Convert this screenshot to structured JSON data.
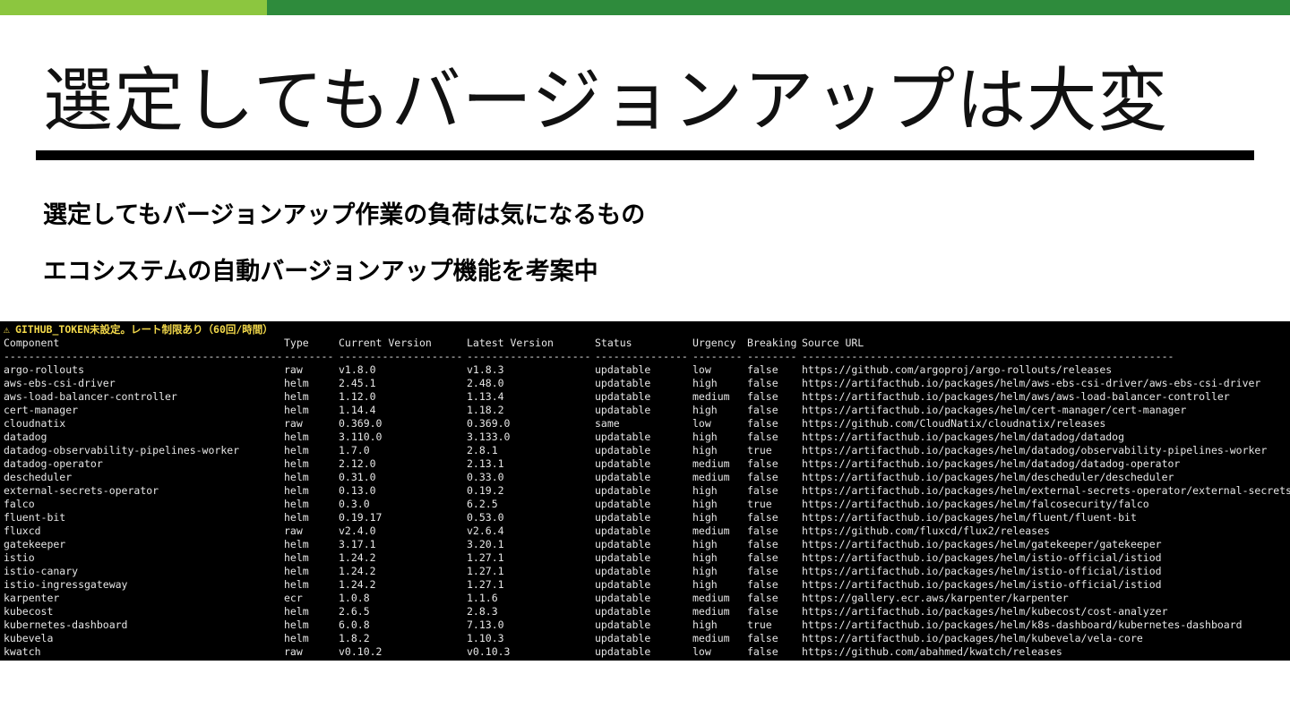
{
  "colors": {
    "bar_left": "#8cc63f",
    "bar_right": "#2e8b3c",
    "warning": "#f2d84a"
  },
  "slide": {
    "title": "選定してもバージョンアップは大変",
    "bullets": [
      "選定してもバージョンアップ作業の負荷は気になるもの",
      "エコシステムの自動バージョンアップ機能を考案中"
    ]
  },
  "terminal": {
    "warning_icon": "⚠",
    "warning_text": "GITHUB_TOKEN未設定。レート制限あり（60回/時間）",
    "headers": [
      "Component",
      "Type",
      "Current Version",
      "Latest Version",
      "Status",
      "Urgency",
      "Breaking",
      "Source URL"
    ],
    "separators": [
      "---------------------------------------------",
      "--------",
      "--------------------",
      "--------------------",
      "---------------",
      "--------",
      "--------",
      "------------------------------------------------------------"
    ],
    "rows": [
      [
        "argo-rollouts",
        "raw",
        "v1.8.0",
        "v1.8.3",
        "updatable",
        "low",
        "false",
        "https://github.com/argoproj/argo-rollouts/releases"
      ],
      [
        "aws-ebs-csi-driver",
        "helm",
        "2.45.1",
        "2.48.0",
        "updatable",
        "high",
        "false",
        "https://artifacthub.io/packages/helm/aws-ebs-csi-driver/aws-ebs-csi-driver"
      ],
      [
        "aws-load-balancer-controller",
        "helm",
        "1.12.0",
        "1.13.4",
        "updatable",
        "medium",
        "false",
        "https://artifacthub.io/packages/helm/aws/aws-load-balancer-controller"
      ],
      [
        "cert-manager",
        "helm",
        "1.14.4",
        "1.18.2",
        "updatable",
        "high",
        "false",
        "https://artifacthub.io/packages/helm/cert-manager/cert-manager"
      ],
      [
        "cloudnatix",
        "raw",
        "0.369.0",
        "0.369.0",
        "same",
        "low",
        "false",
        "https://github.com/CloudNatix/cloudnatix/releases"
      ],
      [
        "datadog",
        "helm",
        "3.110.0",
        "3.133.0",
        "updatable",
        "high",
        "false",
        "https://artifacthub.io/packages/helm/datadog/datadog"
      ],
      [
        "datadog-observability-pipelines-worker",
        "helm",
        "1.7.0",
        "2.8.1",
        "updatable",
        "high",
        "true",
        "https://artifacthub.io/packages/helm/datadog/observability-pipelines-worker"
      ],
      [
        "datadog-operator",
        "helm",
        "2.12.0",
        "2.13.1",
        "updatable",
        "medium",
        "false",
        "https://artifacthub.io/packages/helm/datadog/datadog-operator"
      ],
      [
        "descheduler",
        "helm",
        "0.31.0",
        "0.33.0",
        "updatable",
        "medium",
        "false",
        "https://artifacthub.io/packages/helm/descheduler/descheduler"
      ],
      [
        "external-secrets-operator",
        "helm",
        "0.13.0",
        "0.19.2",
        "updatable",
        "high",
        "false",
        "https://artifacthub.io/packages/helm/external-secrets-operator/external-secrets"
      ],
      [
        "falco",
        "helm",
        "0.3.0",
        "6.2.5",
        "updatable",
        "high",
        "true",
        "https://artifacthub.io/packages/helm/falcosecurity/falco"
      ],
      [
        "fluent-bit",
        "helm",
        "0.19.17",
        "0.53.0",
        "updatable",
        "high",
        "false",
        "https://artifacthub.io/packages/helm/fluent/fluent-bit"
      ],
      [
        "fluxcd",
        "raw",
        "v2.4.0",
        "v2.6.4",
        "updatable",
        "medium",
        "false",
        "https://github.com/fluxcd/flux2/releases"
      ],
      [
        "gatekeeper",
        "helm",
        "3.17.1",
        "3.20.1",
        "updatable",
        "high",
        "false",
        "https://artifacthub.io/packages/helm/gatekeeper/gatekeeper"
      ],
      [
        "istio",
        "helm",
        "1.24.2",
        "1.27.1",
        "updatable",
        "high",
        "false",
        "https://artifacthub.io/packages/helm/istio-official/istiod"
      ],
      [
        "istio-canary",
        "helm",
        "1.24.2",
        "1.27.1",
        "updatable",
        "high",
        "false",
        "https://artifacthub.io/packages/helm/istio-official/istiod"
      ],
      [
        "istio-ingressgateway",
        "helm",
        "1.24.2",
        "1.27.1",
        "updatable",
        "high",
        "false",
        "https://artifacthub.io/packages/helm/istio-official/istiod"
      ],
      [
        "karpenter",
        "ecr",
        "1.0.8",
        "1.1.6",
        "updatable",
        "medium",
        "false",
        "https://gallery.ecr.aws/karpenter/karpenter"
      ],
      [
        "kubecost",
        "helm",
        "2.6.5",
        "2.8.3",
        "updatable",
        "medium",
        "false",
        "https://artifacthub.io/packages/helm/kubecost/cost-analyzer"
      ],
      [
        "kubernetes-dashboard",
        "helm",
        "6.0.8",
        "7.13.0",
        "updatable",
        "high",
        "true",
        "https://artifacthub.io/packages/helm/k8s-dashboard/kubernetes-dashboard"
      ],
      [
        "kubevela",
        "helm",
        "1.8.2",
        "1.10.3",
        "updatable",
        "medium",
        "false",
        "https://artifacthub.io/packages/helm/kubevela/vela-core"
      ],
      [
        "kwatch",
        "raw",
        "v0.10.2",
        "v0.10.3",
        "updatable",
        "low",
        "false",
        "https://github.com/abahmed/kwatch/releases"
      ]
    ]
  }
}
